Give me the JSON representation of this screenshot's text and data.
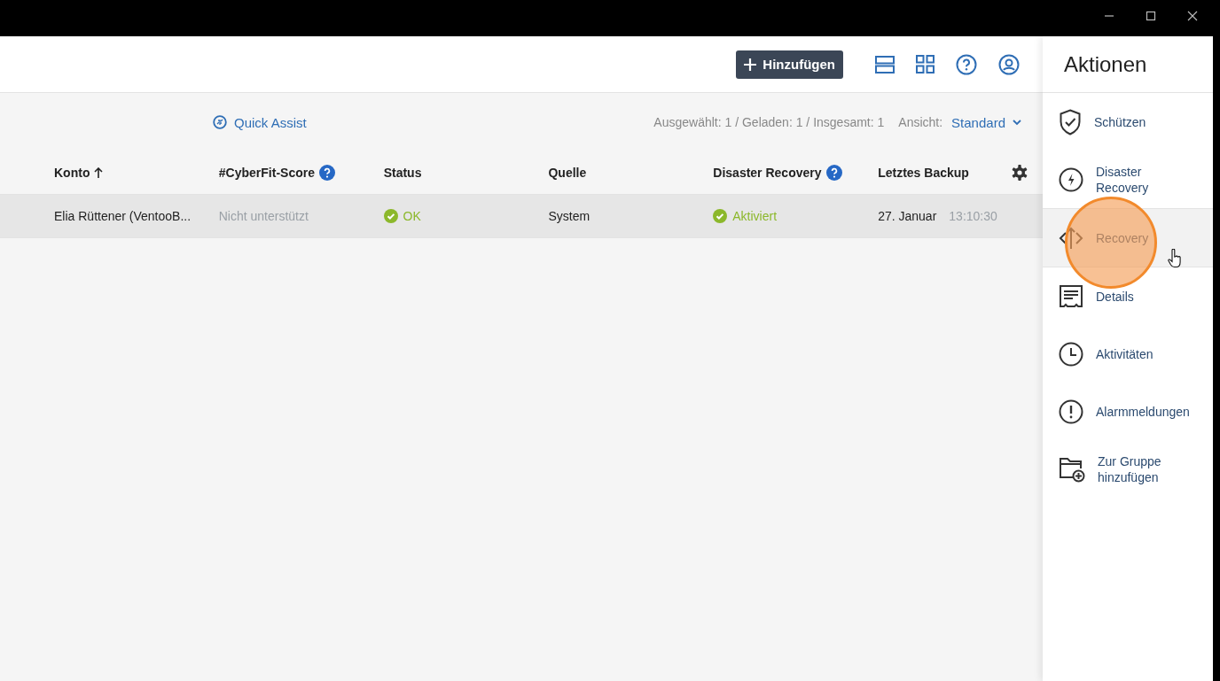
{
  "toolbar": {
    "add_button": "Hinzufügen"
  },
  "subbar": {
    "quick_assist": "Quick Assist",
    "summary": "Ausgewählt: 1 / Geladen: 1 / Insgesamt: 1",
    "view_label": "Ansicht:",
    "view_value": "Standard"
  },
  "table": {
    "columns": [
      {
        "label": "Konto",
        "sorted": true,
        "help": false
      },
      {
        "label": "#CyberFit-Score",
        "sorted": false,
        "help": true
      },
      {
        "label": "Status",
        "sorted": false,
        "help": false
      },
      {
        "label": "Quelle",
        "sorted": false,
        "help": false
      },
      {
        "label": "Disaster Recovery",
        "sorted": false,
        "help": true
      },
      {
        "label": "Letztes Backup",
        "sorted": false,
        "help": false
      }
    ],
    "rows": [
      {
        "selected": true,
        "cells": [
          {
            "kind": "text",
            "text": "Elia Rüttener (VentooB..."
          },
          {
            "kind": "muted",
            "text": "Nicht unterstützt"
          },
          {
            "kind": "ok",
            "text": "OK"
          },
          {
            "kind": "text",
            "text": "System"
          },
          {
            "kind": "ok",
            "text": "Aktiviert"
          },
          {
            "kind": "datetime",
            "date": "27. Januar",
            "time": "13:10:30"
          }
        ]
      }
    ]
  },
  "actions": {
    "title": "Aktionen",
    "items": [
      {
        "label": "Schützen",
        "hovered": false
      },
      {
        "label": "Disaster Recovery",
        "hovered": false
      },
      {
        "label": "Recovery",
        "hovered": true
      },
      {
        "label": "Details",
        "hovered": false
      },
      {
        "label": "Aktivitäten",
        "hovered": false
      },
      {
        "label": "Alarmmeldungen",
        "hovered": false
      },
      {
        "label": "Zur Gruppe hinzufügen",
        "hovered": false
      }
    ]
  }
}
